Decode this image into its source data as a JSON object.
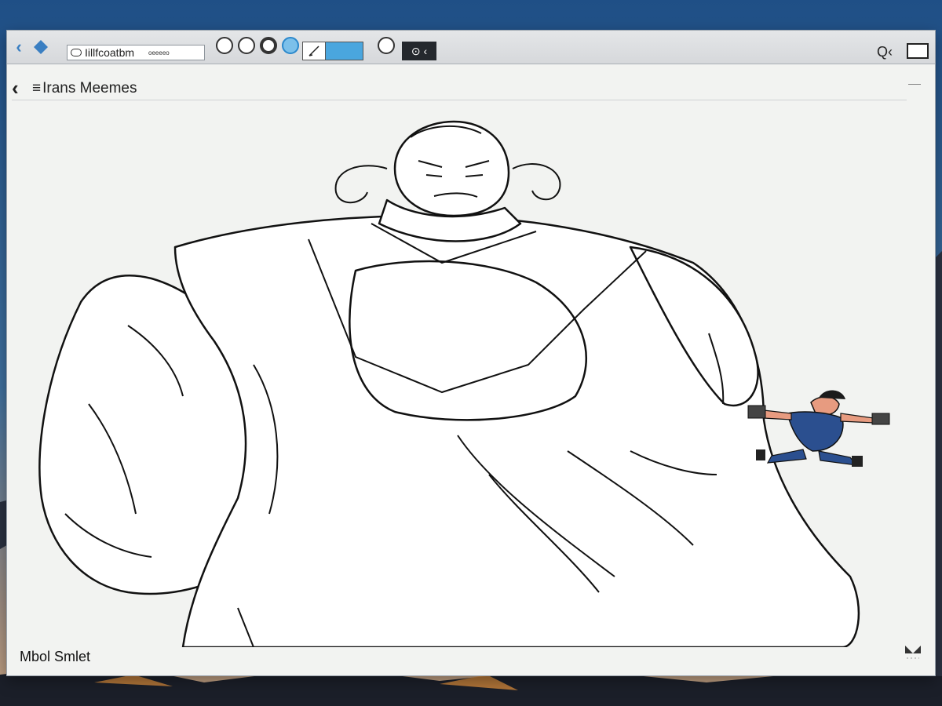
{
  "desktop": {
    "sky_top": "#1f4f86",
    "sky_bottom": "#c7a27f"
  },
  "toolbar": {
    "address_text": "Iillfcoatbm",
    "address_sub": "oeeeeo",
    "dark_button_label": "⊙ ‹",
    "search_label": "Q‹"
  },
  "page": {
    "back_symbol": "‹",
    "title": "Irans Meemes",
    "footer_text": "Mbol Smlet"
  },
  "colors": {
    "accent": "#3a7fc2",
    "blue_fill": "#4aa6de",
    "dark_button": "#24282d"
  }
}
